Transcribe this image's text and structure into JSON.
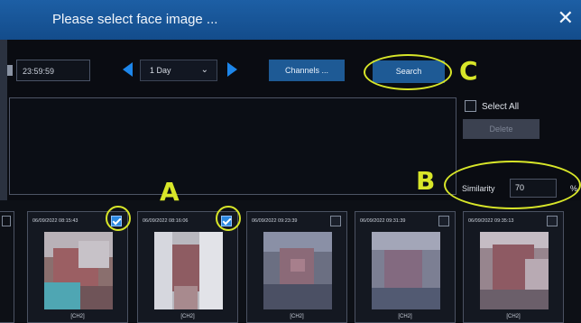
{
  "dialog": {
    "title": "Please select face image ...",
    "close_icon": "close-icon"
  },
  "toolbar": {
    "end_time": "23:59:59",
    "period": "1 Day",
    "channels_label": "Channels ...",
    "search_label": "Search"
  },
  "side": {
    "select_all_label": "Select All",
    "delete_label": "Delete",
    "similarity_label": "Similarity",
    "similarity_value": "70",
    "similarity_unit": "%"
  },
  "thumbnails": [
    {
      "timestamp": "06/09/2022 08:15:43",
      "channel": "[CH2]",
      "checked": true
    },
    {
      "timestamp": "06/09/2022 08:16:06",
      "channel": "[CH2]",
      "checked": true
    },
    {
      "timestamp": "06/09/2022 09:23:39",
      "channel": "[CH2]",
      "checked": false
    },
    {
      "timestamp": "06/09/2022 09:31:39",
      "channel": "[CH2]",
      "checked": false
    },
    {
      "timestamp": "06/09/2022 09:35:13",
      "channel": "[CH2]",
      "checked": false
    }
  ],
  "annotations": {
    "a": "A",
    "b": "B",
    "c": "C",
    "color": "#d8e629"
  },
  "colors": {
    "titlebar": "#1d5fa5",
    "accent": "#1d86ea",
    "button": "#1e5a95"
  }
}
